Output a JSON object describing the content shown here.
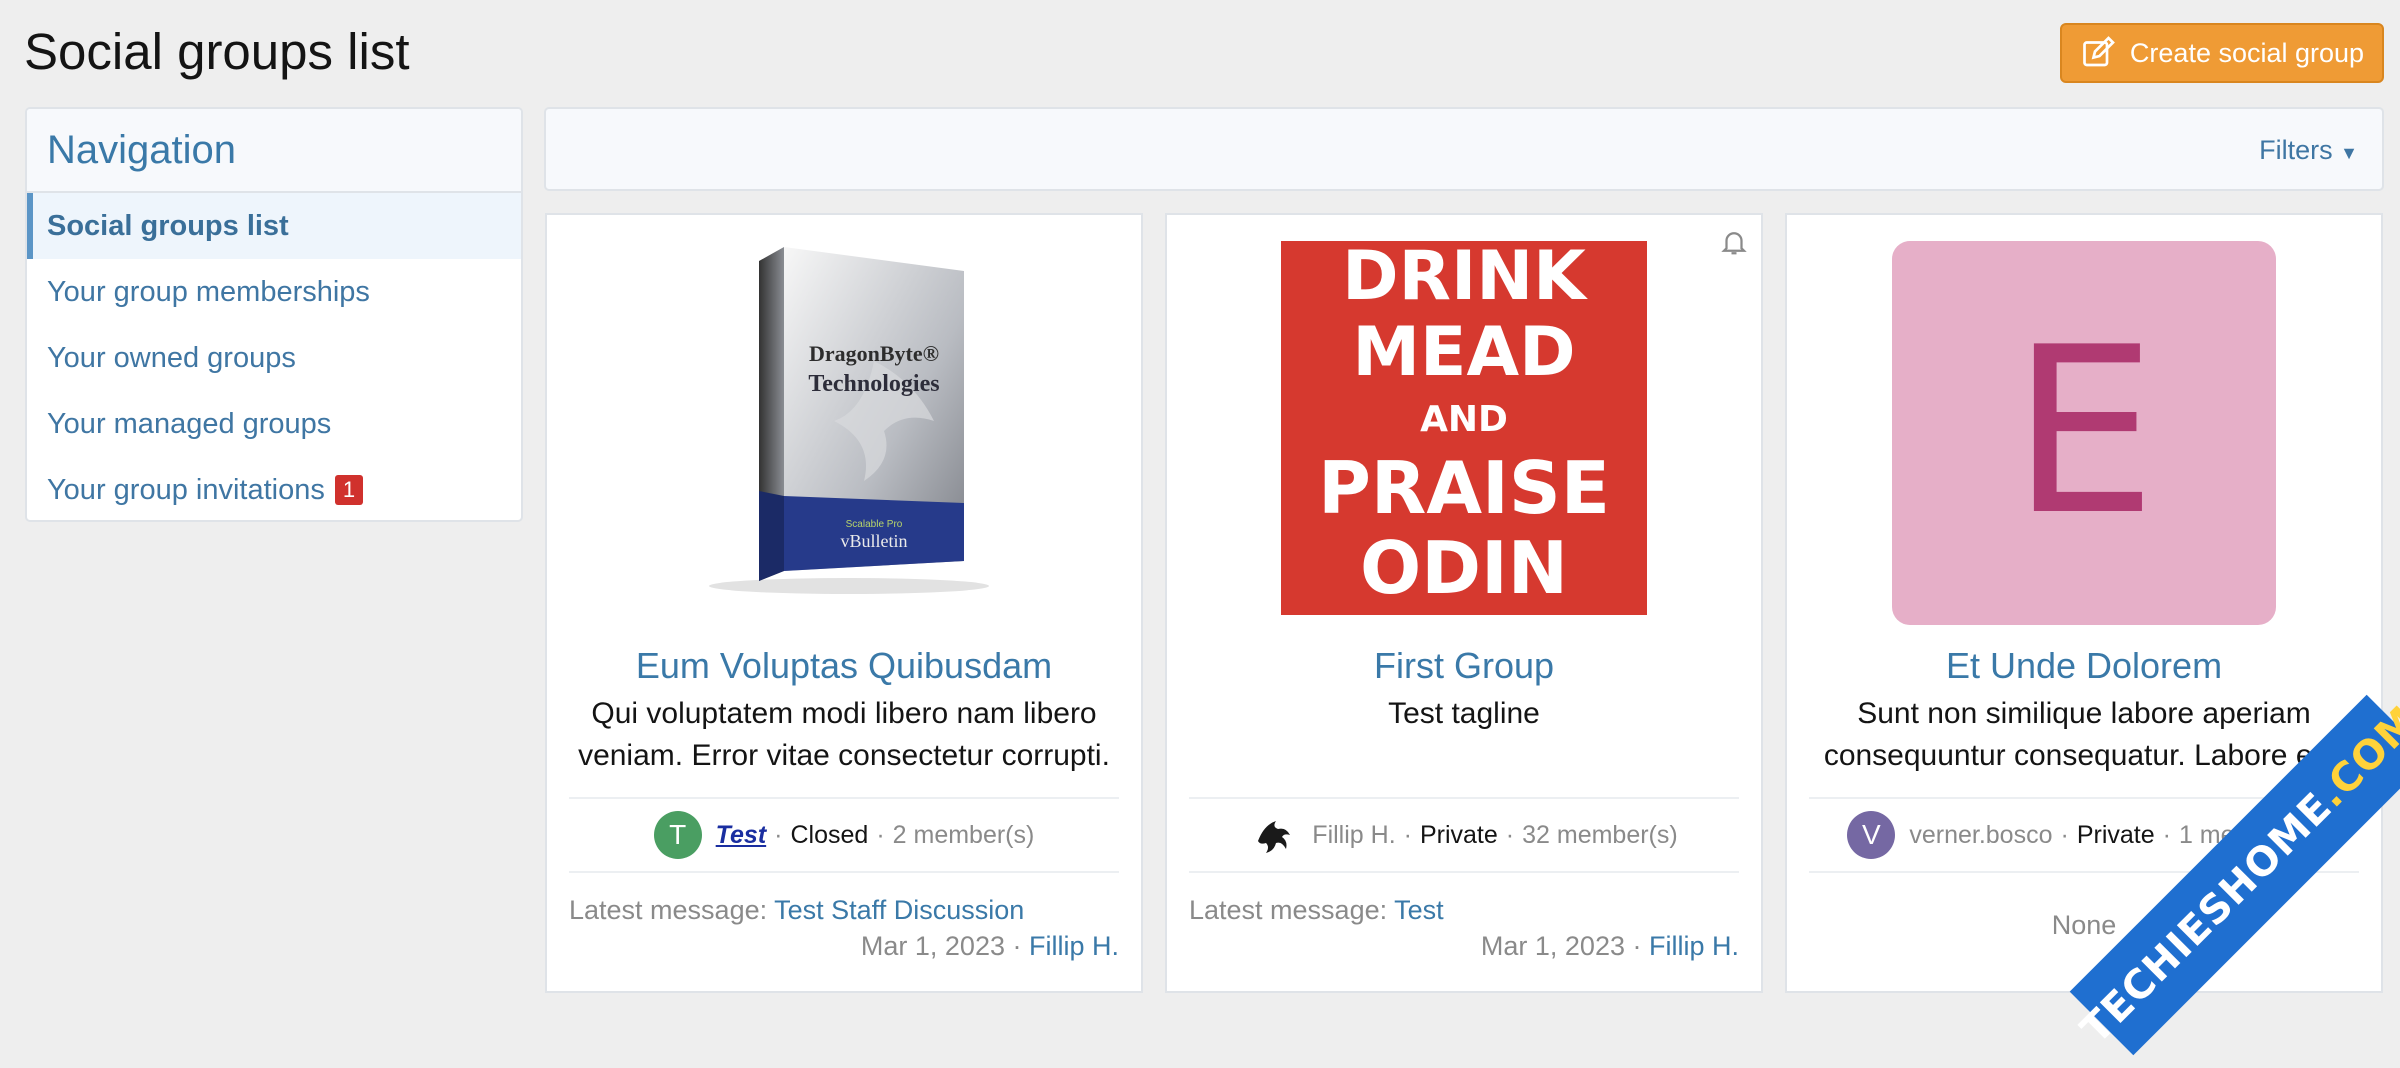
{
  "page": {
    "title": "Social groups list"
  },
  "header": {
    "create_label": "Create social group"
  },
  "navigation": {
    "heading": "Navigation",
    "items": [
      {
        "label": "Social groups list",
        "active": true
      },
      {
        "label": "Your group memberships"
      },
      {
        "label": "Your owned groups"
      },
      {
        "label": "Your managed groups"
      },
      {
        "label": "Your group invitations",
        "badge": "1"
      }
    ]
  },
  "filters": {
    "label": "Filters"
  },
  "groups": [
    {
      "name": "Eum Voluptas Quibusdam",
      "tagline": "Qui voluptatem modi libero nam libero veniam. Error vitae consectetur corrupti.",
      "owner": "Test",
      "owner_avatar_letter": "T",
      "privacy": "Closed",
      "members": "2 member(s)",
      "latest_label": "Latest message:",
      "latest_link": "Test Staff Discussion",
      "date": "Mar 1, 2023",
      "date_user": "Fillip H.",
      "image_box_top": "DragonByte®",
      "image_box_main": "Technologies",
      "image_box_bottom_small": "Scalable Pro",
      "image_box_bottom": "vBulletin"
    },
    {
      "name": "First Group",
      "tagline": "Test tagline",
      "owner": "Fillip H.",
      "privacy": "Private",
      "members": "32 member(s)",
      "latest_label": "Latest message:",
      "latest_link": "Test",
      "date": "Mar 1, 2023",
      "date_user": "Fillip H.",
      "image_text": [
        "DRINK",
        "MEAD",
        "AND",
        "PRAISE",
        "ODIN"
      ]
    },
    {
      "name": "Et Unde Dolorem",
      "tagline": "Sunt non similique labore aperiam consequuntur consequatur. Labore est.",
      "owner": "verner.bosco",
      "owner_avatar_letter": "V",
      "privacy": "Private",
      "members": "1 member(s)",
      "latest_none": "None",
      "image_letter": "E"
    }
  ],
  "watermark": {
    "main": "TECHIESHOME",
    "suffix": ".COM"
  },
  "colors": {
    "accent_orange": "#ef9b35",
    "link_blue": "#3a79a8",
    "card_red": "#d6392f",
    "card_pink": "#e6afc8",
    "letter_magenta": "#b03a72",
    "avatar_green": "#4a9e62",
    "avatar_purple": "#7568a3"
  }
}
